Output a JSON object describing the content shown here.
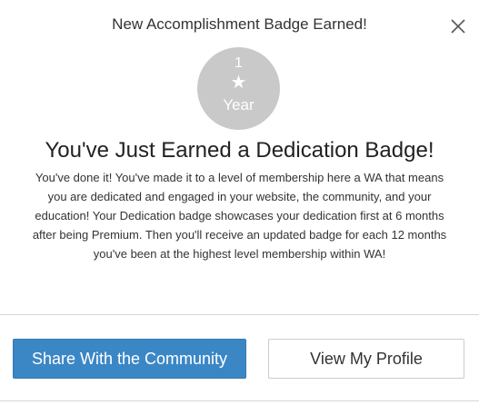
{
  "modal": {
    "title": "New Accomplishment Badge Earned!",
    "close_icon": "close-icon"
  },
  "badge": {
    "number": "1",
    "star_icon": "star-icon",
    "star_glyph": "★",
    "unit": "Year",
    "color": "#c9c9c9"
  },
  "headline": "You've Just Earned a Dedication Badge!",
  "body": "You've done it! You've made it to a level of membership here a WA that means you are dedicated and engaged in your website, the community, and your education! Your Dedication badge showcases your dedication first at 6 months after being Premium. Then you'll receive an updated badge for each 12 months you've been at the highest level membership within WA!",
  "actions": {
    "share_label": "Share With the Community",
    "profile_label": "View My Profile",
    "primary_color": "#3b87c6"
  }
}
